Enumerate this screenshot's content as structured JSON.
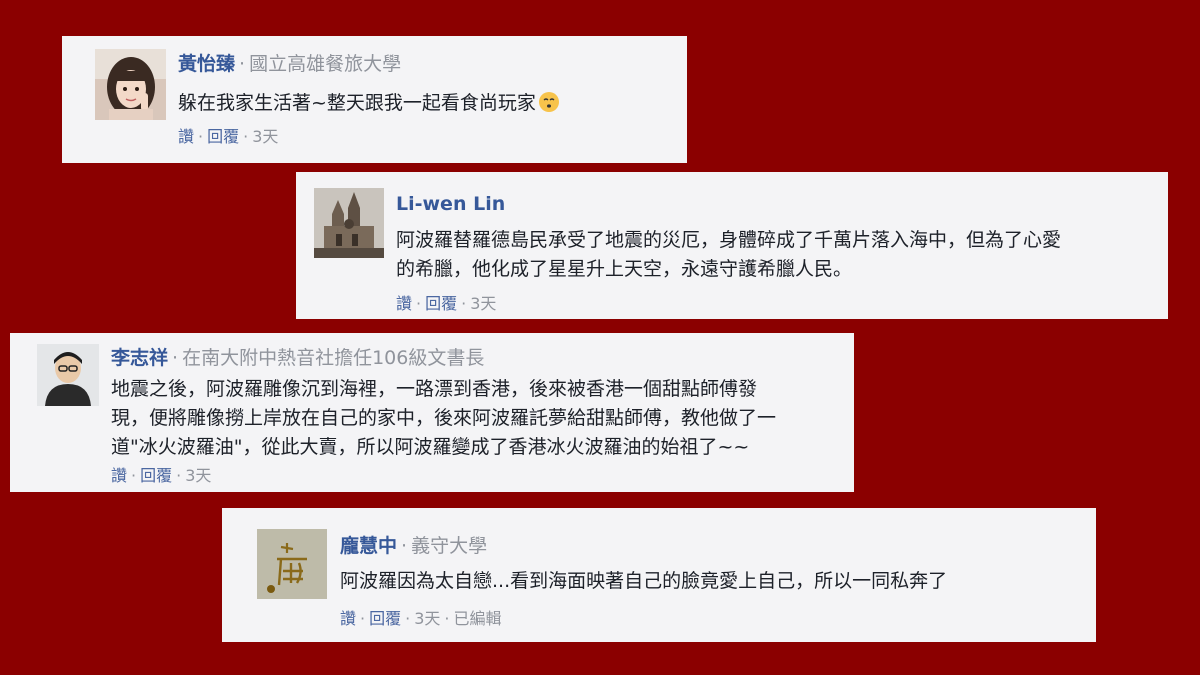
{
  "comments": [
    {
      "name": "黃怡臻",
      "affiliation": "國立高雄餐旅大學",
      "lines": [
        "躲在我家生活著~整天跟我一起看食尚玩家"
      ],
      "emoji": "kissing-face-emoji",
      "actions": {
        "like": "讚",
        "reply": "回覆",
        "time": "3天"
      }
    },
    {
      "name": "Li-wen Lin",
      "affiliation": "",
      "lines": [
        "阿波羅替羅德島民承受了地震的災厄，身體碎成了千萬片落入海中，但為了心愛",
        "的希臘，他化成了星星升上天空，永遠守護希臘人民。"
      ],
      "actions": {
        "like": "讚",
        "reply": "回覆",
        "time": "3天"
      }
    },
    {
      "name": "李志祥",
      "affiliation": "在南大附中熱音社擔任106級文書長",
      "lines": [
        "地震之後，阿波羅雕像沉到海裡，一路漂到香港，後來被香港一個甜點師傅發",
        "現，便將雕像撈上岸放在自己的家中，後來阿波羅託夢給甜點師傅，教他做了一",
        "道\"冰火波羅油\"，從此大賣，所以阿波羅變成了香港冰火波羅油的始祖了~~"
      ],
      "actions": {
        "like": "讚",
        "reply": "回覆",
        "time": "3天"
      }
    },
    {
      "name": "龐慧中",
      "affiliation": "義守大學",
      "lines": [
        "阿波羅因為太自戀...看到海面映著自己的臉竟愛上自己，所以一同私奔了"
      ],
      "actions": {
        "like": "讚",
        "reply": "回覆",
        "time": "3天",
        "edited": "已編輯"
      }
    }
  ],
  "colors": {
    "background": "#8b0000",
    "card": "#f4f4f6",
    "name": "#365899",
    "muted": "#90949c",
    "text": "#1d2129",
    "link": "#4b67a1"
  }
}
